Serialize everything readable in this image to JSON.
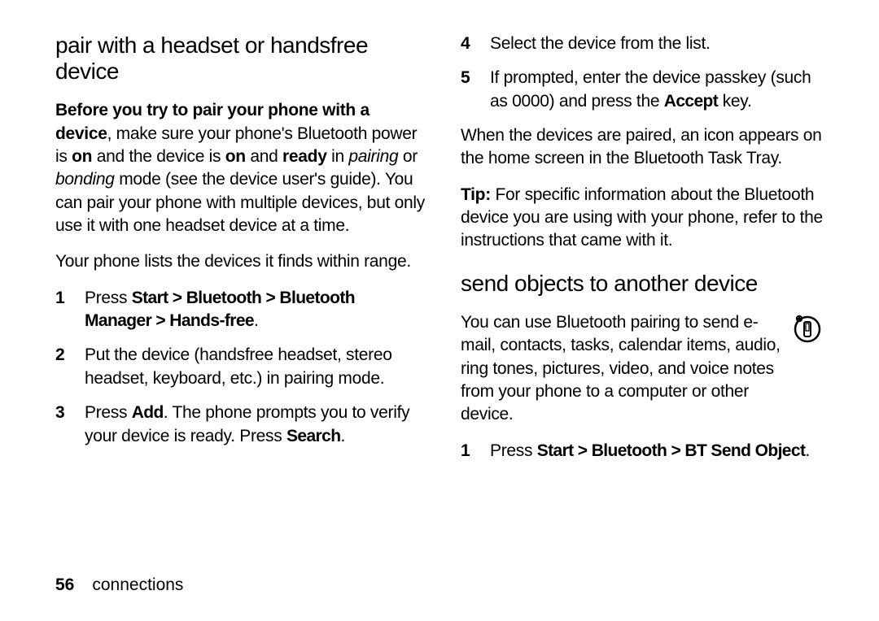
{
  "left": {
    "heading": "pair with a headset or handsfree device",
    "para1_a": "Before you try to pair your phone with a device",
    "para1_b": ", make sure your phone's Bluetooth power is ",
    "para1_on1": "on",
    "para1_c": " and the device is ",
    "para1_on2": "on",
    "para1_d": " and ",
    "para1_ready": "ready",
    "para1_e": " in ",
    "para1_pairing": "pairing",
    "para1_f": " or ",
    "para1_bonding": "bonding",
    "para1_g": " mode (see the device user's guide). You can pair your phone with multiple devices, but only use it with one headset device at a time.",
    "para2": "Your phone lists the devices it finds within range.",
    "step1_a": "Press ",
    "step1_path": "Start > Bluetooth > Bluetooth Manager > Hands-free",
    "step1_b": ".",
    "step2": "Put the device (handsfree headset, stereo headset, keyboard, etc.) in pairing mode.",
    "step3_a": "Press ",
    "step3_add": "Add",
    "step3_b": ". The phone prompts you to verify your device is ready. Press ",
    "step3_search": "Search",
    "step3_c": "."
  },
  "right": {
    "step4": "Select the device from the list.",
    "step5_a": "If prompted, enter the device passkey (such as 0000) and press the ",
    "step5_accept": "Accept",
    "step5_b": " key.",
    "para_after": "When the devices are paired, an icon appears on the home screen in the Bluetooth Task Tray.",
    "tip_label": "Tip:",
    "tip_text": " For specific information about the Bluetooth device you are using with your phone, refer to the instructions that came with it.",
    "heading2": "send objects to another device",
    "send_intro": "You can use Bluetooth pairing to send e-mail, contacts, tasks, calendar items, audio, ring tones, pictures, video, and voice notes from your phone to a computer or other device.",
    "send1_a": "Press ",
    "send1_path": "Start > Bluetooth > BT Send Object",
    "send1_b": "."
  },
  "footer": {
    "pagenum": "56",
    "section": "connections"
  },
  "nums": {
    "n1": "1",
    "n2": "2",
    "n3": "3",
    "n4": "4",
    "n5": "5"
  }
}
